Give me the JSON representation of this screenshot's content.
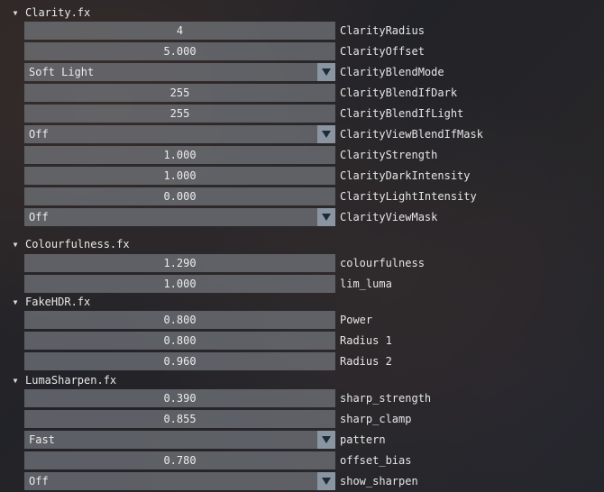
{
  "colors": {
    "field_bg": "#80848a",
    "combo_button": "#96a4b2",
    "text": "#e6e6e6"
  },
  "clarity": {
    "title": "Clarity.fx",
    "rows": [
      {
        "type": "slider",
        "value": "4",
        "label": "ClarityRadius"
      },
      {
        "type": "slider",
        "value": "5.000",
        "label": "ClarityOffset"
      },
      {
        "type": "combo",
        "value": "Soft Light",
        "label": "ClarityBlendMode"
      },
      {
        "type": "slider",
        "value": "255",
        "label": "ClarityBlendIfDark"
      },
      {
        "type": "slider",
        "value": "255",
        "label": "ClarityBlendIfLight"
      },
      {
        "type": "combo",
        "value": "Off",
        "label": "ClarityViewBlendIfMask"
      },
      {
        "type": "slider",
        "value": "1.000",
        "label": "ClarityStrength"
      },
      {
        "type": "slider",
        "value": "1.000",
        "label": "ClarityDarkIntensity"
      },
      {
        "type": "slider",
        "value": "0.000",
        "label": "ClarityLightIntensity"
      },
      {
        "type": "combo",
        "value": "Off",
        "label": "ClarityViewMask"
      }
    ]
  },
  "colourfulness": {
    "title": "Colourfulness.fx",
    "rows": [
      {
        "type": "slider",
        "value": "1.290",
        "label": "colourfulness"
      },
      {
        "type": "slider",
        "value": "1.000",
        "label": "lim_luma"
      }
    ]
  },
  "fakehdr": {
    "title": "FakeHDR.fx",
    "rows": [
      {
        "type": "slider",
        "value": "0.800",
        "label": "Power"
      },
      {
        "type": "slider",
        "value": "0.800",
        "label": "Radius 1"
      },
      {
        "type": "slider",
        "value": "0.960",
        "label": "Radius 2"
      }
    ]
  },
  "lumasharpen": {
    "title": "LumaSharpen.fx",
    "rows": [
      {
        "type": "slider",
        "value": "0.390",
        "label": "sharp_strength"
      },
      {
        "type": "slider",
        "value": "0.855",
        "label": "sharp_clamp"
      },
      {
        "type": "combo",
        "value": "Fast",
        "label": "pattern"
      },
      {
        "type": "slider",
        "value": "0.780",
        "label": "offset_bias"
      },
      {
        "type": "combo",
        "value": "Off",
        "label": "show_sharpen"
      }
    ]
  }
}
